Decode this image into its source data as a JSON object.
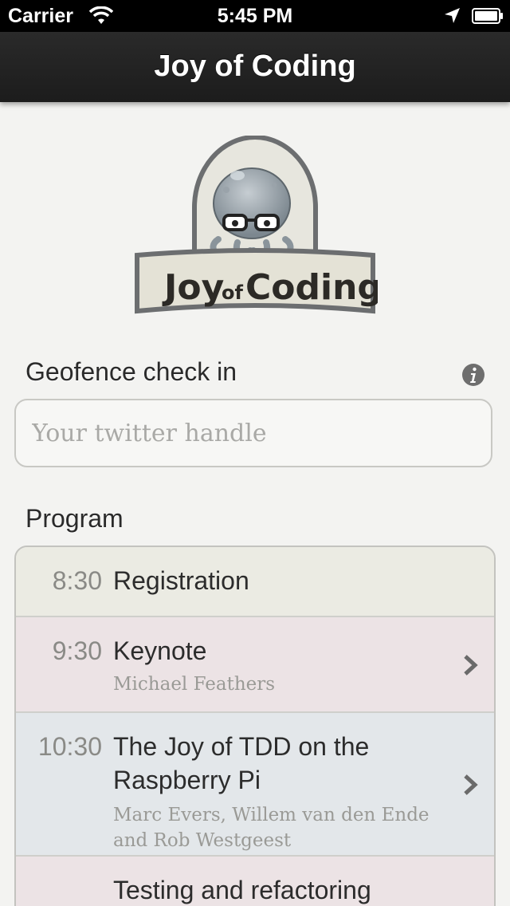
{
  "status_bar": {
    "carrier": "Carrier",
    "time": "5:45 PM"
  },
  "nav": {
    "title": "Joy of Coding"
  },
  "logo": {
    "text_joy": "Joy",
    "text_of": "of",
    "text_coding": "Coding"
  },
  "geofence": {
    "label": "Geofence check in",
    "placeholder": "Your twitter handle",
    "value": ""
  },
  "program": {
    "label": "Program",
    "items": [
      {
        "time": "8:30",
        "title": "Registration",
        "speaker": "",
        "color": "#ebebe3",
        "has_chevron": false
      },
      {
        "time": "9:30",
        "title": "Keynote",
        "speaker": "Michael Feathers",
        "color": "#ece3e5",
        "has_chevron": true
      },
      {
        "time": "10:30",
        "title": "The Joy of TDD on the Raspberry Pi",
        "speaker": "Marc Evers, Willem van den Ende and Rob Westgeest",
        "color": "#e3e7ea",
        "has_chevron": true
      },
      {
        "time": "",
        "title": "Testing and refactoring",
        "speaker": "",
        "color": "#ece3e5",
        "has_chevron": false
      }
    ]
  },
  "icons": {
    "wifi": "wifi-icon",
    "location": "location-arrow-icon",
    "battery": "battery-icon",
    "info": "info-icon",
    "chevron": "chevron-right-icon"
  }
}
